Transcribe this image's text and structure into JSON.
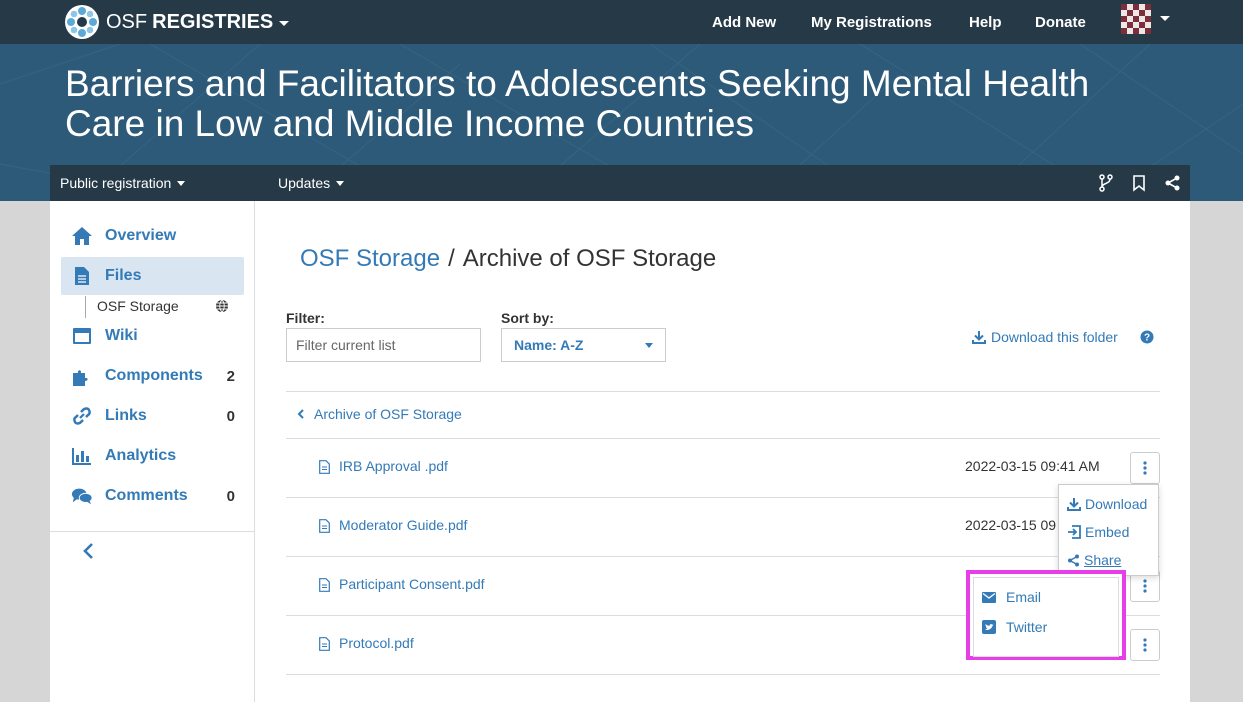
{
  "topnav": {
    "brand_prefix": "OSF",
    "brand_name": "REGISTRIES",
    "links": [
      "Add New",
      "My Registrations",
      "Help",
      "Donate"
    ]
  },
  "header": {
    "title": "Barriers and Facilitators to Adolescents Seeking Mental Health Care in Low and Middle Income Countries"
  },
  "subnav": {
    "registration_label": "Public registration",
    "updates_label": "Updates",
    "icons": [
      "fork-icon",
      "bookmark-icon",
      "share-icon"
    ]
  },
  "sidebar": {
    "items": [
      {
        "label": "Overview",
        "icon": "home-icon",
        "count": ""
      },
      {
        "label": "Files",
        "icon": "file-icon",
        "count": ""
      },
      {
        "label": "Wiki",
        "icon": "wiki-icon",
        "count": ""
      },
      {
        "label": "Components",
        "icon": "puzzle-icon",
        "count": "2"
      },
      {
        "label": "Links",
        "icon": "link-icon",
        "count": "0"
      },
      {
        "label": "Analytics",
        "icon": "bar-chart-icon",
        "count": ""
      },
      {
        "label": "Comments",
        "icon": "comments-icon",
        "count": "0"
      }
    ],
    "sub_item": "OSF Storage"
  },
  "content": {
    "breadcrumb_link": "OSF Storage",
    "breadcrumb_sep": "/",
    "breadcrumb_current": "Archive of OSF Storage",
    "filter_label": "Filter:",
    "filter_placeholder": "Filter current list",
    "sort_label": "Sort by:",
    "sort_value": "Name: A-Z",
    "download_folder": "Download this folder",
    "back_label": "Archive of OSF Storage",
    "files": [
      {
        "name": "IRB Approval .pdf",
        "date": "2022-03-15 09:41 AM"
      },
      {
        "name": "Moderator Guide.pdf",
        "date": "2022-03-15 09"
      },
      {
        "name": "Participant Consent.pdf",
        "date": ""
      },
      {
        "name": "Protocol.pdf",
        "date": ""
      }
    ]
  },
  "file_menu": {
    "download": "Download",
    "embed": "Embed",
    "share": "Share"
  },
  "share_menu": {
    "email": "Email",
    "twitter": "Twitter"
  },
  "colors": {
    "navbar": "#263947",
    "header": "#2d5a78",
    "link": "#337ab7",
    "highlight": "#e83ee8",
    "active_bg": "#d9e6f2"
  }
}
